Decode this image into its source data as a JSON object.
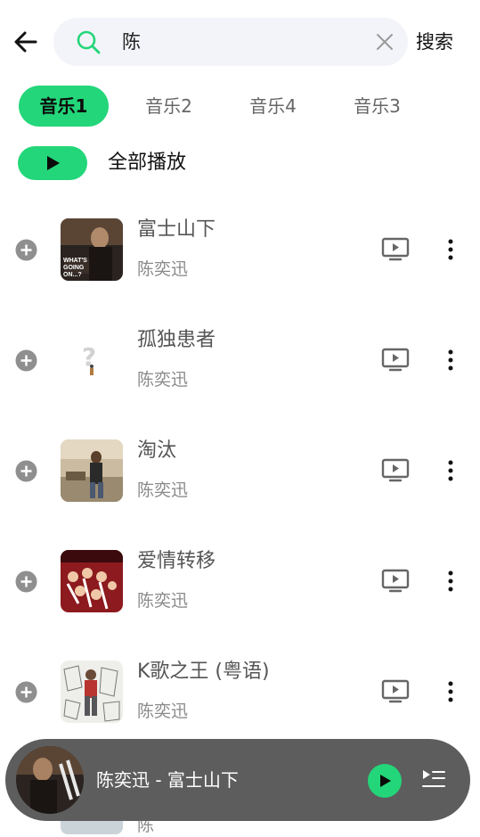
{
  "search": {
    "query": "陈",
    "button_label": "搜索"
  },
  "tabs": [
    {
      "label": "音乐1",
      "active": true
    },
    {
      "label": "音乐2",
      "active": false
    },
    {
      "label": "音乐4",
      "active": false
    },
    {
      "label": "音乐3",
      "active": false
    }
  ],
  "play_all": {
    "label": "全部播放"
  },
  "songs": [
    {
      "title": "富士山下",
      "artist": "陈奕迅",
      "cover_text": "WHAT'S GOING ON...?"
    },
    {
      "title": "孤独患者",
      "artist": "陈奕迅",
      "cover_text": "?"
    },
    {
      "title": "淘汰",
      "artist": "陈奕迅",
      "cover_text": ""
    },
    {
      "title": "爱情转移",
      "artist": "陈奕迅",
      "cover_text": ""
    },
    {
      "title": "K歌之王 (粤语)",
      "artist": "陈奕迅",
      "cover_text": ""
    }
  ],
  "peek": {
    "artist": "陈"
  },
  "mini_player": {
    "now_playing": "陈奕迅 - 富士山下"
  },
  "colors": {
    "accent": "#23d679",
    "player_bg": "#5d5d5d",
    "search_bg": "#f3f4f9"
  },
  "icons": {
    "back": "arrow-left-icon",
    "search": "search-icon",
    "clear": "close-icon",
    "play": "play-icon",
    "add": "add-circle-icon",
    "mv": "video-icon",
    "more": "more-vertical-icon",
    "playlist": "playlist-icon"
  }
}
